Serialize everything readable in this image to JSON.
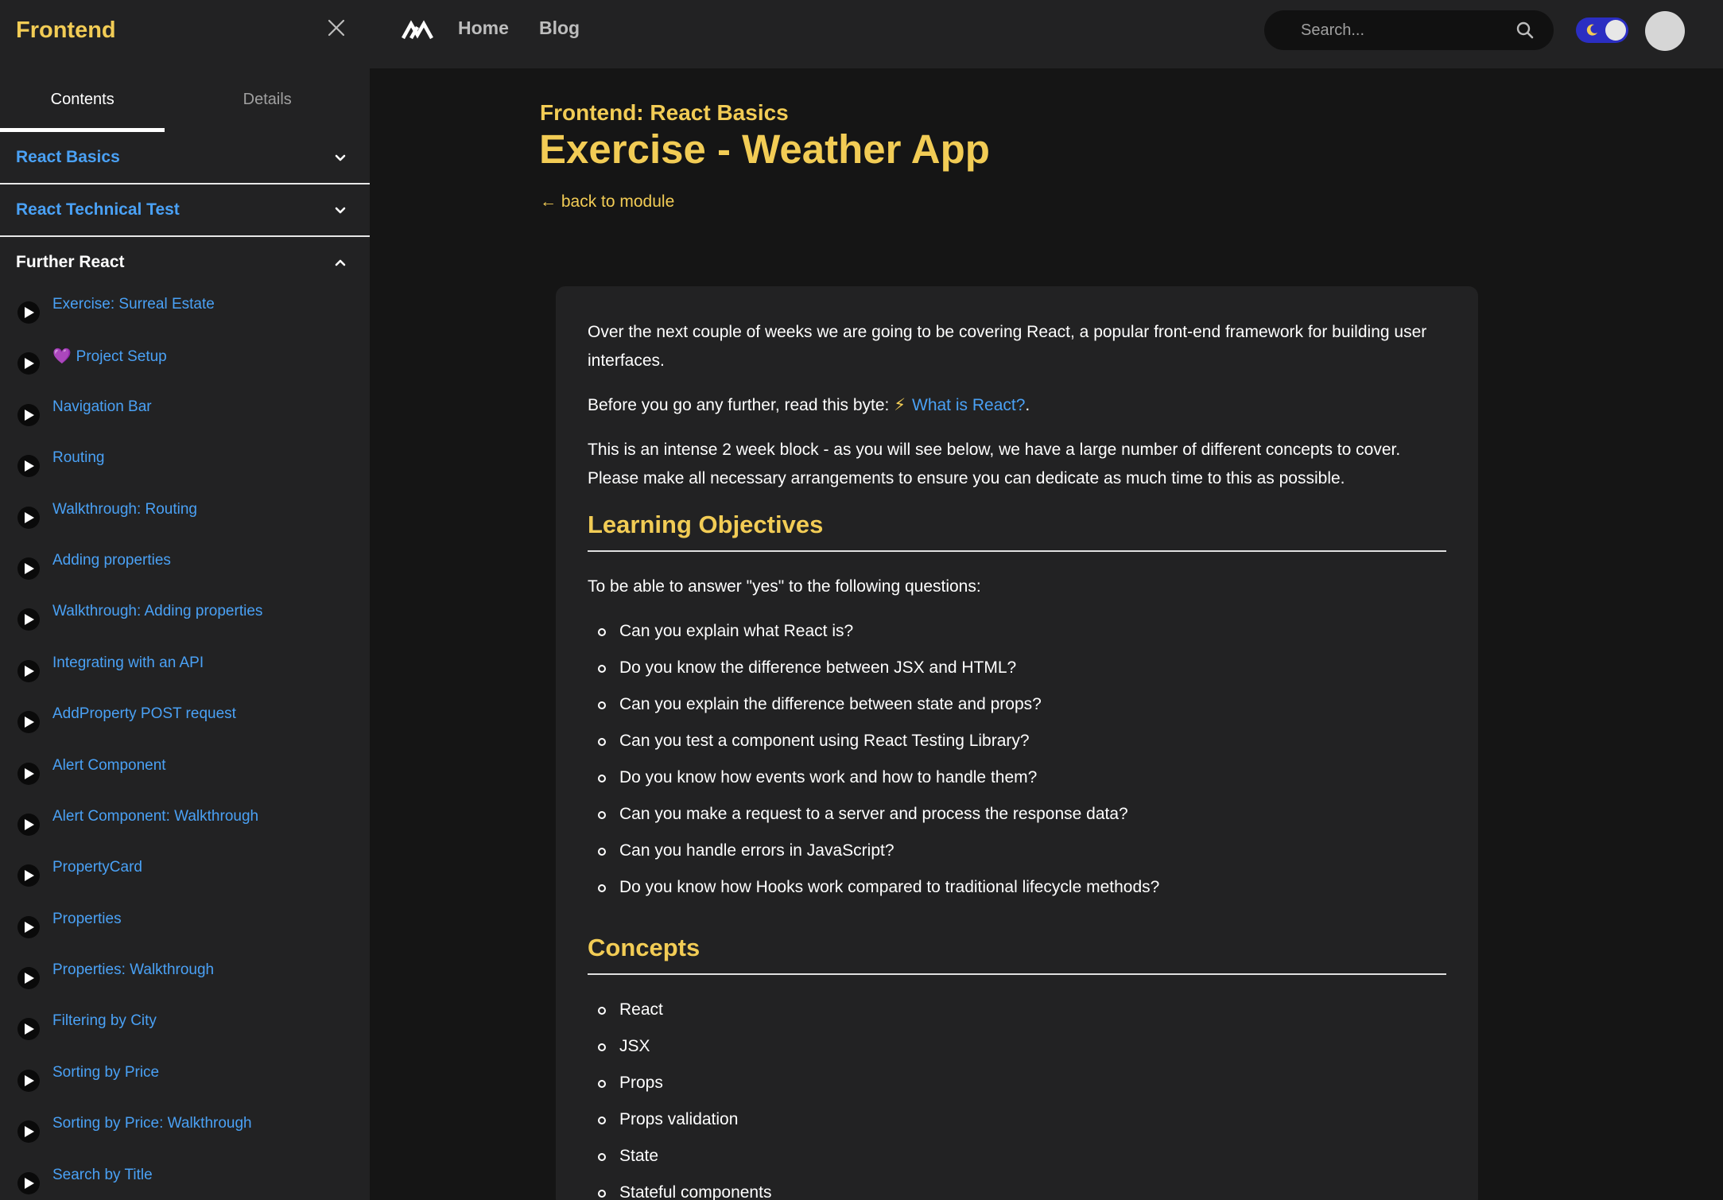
{
  "sidebar": {
    "title": "Frontend",
    "tabs": [
      "Contents",
      "Details"
    ],
    "sections": [
      {
        "label": "React Basics",
        "expanded": false
      },
      {
        "label": "React Technical Test",
        "expanded": false
      },
      {
        "label": "Further React",
        "expanded": true
      }
    ],
    "lessons": [
      {
        "label": "Exercise: Surreal Estate",
        "emoji": ""
      },
      {
        "label": "Project Setup",
        "emoji": "💜"
      },
      {
        "label": "Navigation Bar",
        "emoji": ""
      },
      {
        "label": "Routing",
        "emoji": ""
      },
      {
        "label": "Walkthrough: Routing",
        "emoji": ""
      },
      {
        "label": "Adding properties",
        "emoji": ""
      },
      {
        "label": "Walkthrough: Adding properties",
        "emoji": ""
      },
      {
        "label": "Integrating with an API",
        "emoji": ""
      },
      {
        "label": "AddProperty POST request",
        "emoji": ""
      },
      {
        "label": "Alert Component",
        "emoji": ""
      },
      {
        "label": "Alert Component: Walkthrough",
        "emoji": ""
      },
      {
        "label": "PropertyCard",
        "emoji": ""
      },
      {
        "label": "Properties",
        "emoji": ""
      },
      {
        "label": "Properties: Walkthrough",
        "emoji": ""
      },
      {
        "label": "Filtering by City",
        "emoji": ""
      },
      {
        "label": "Sorting by Price",
        "emoji": ""
      },
      {
        "label": "Sorting by Price: Walkthrough",
        "emoji": ""
      },
      {
        "label": "Search by Title",
        "emoji": ""
      }
    ]
  },
  "topbar": {
    "nav": [
      "Home",
      "Blog"
    ],
    "search_placeholder": "Search...",
    "theme_toggle": "dark"
  },
  "main": {
    "eyebrow": "Frontend: React Basics",
    "title": "Exercise - Weather App",
    "back_link": "← back to module",
    "intro1": "Over the next couple of weeks we are going to be covering React, a popular front-end framework for building user interfaces.",
    "intro2_prefix": "Before you go any further, read this byte:",
    "intro2_link": "What is React?",
    "intro2_suffix": ".",
    "intro3": "This is an intense 2 week block - as you will see below, we have a large number of different concepts to cover. Please make all necessary arrangements to ensure you can dedicate as much time to this as possible.",
    "objectives_heading": "Learning Objectives",
    "objectives_intro": "To be able to answer \"yes\" to the following questions:",
    "objectives": [
      "Can you explain what React is?",
      "Do you know the difference between JSX and HTML?",
      "Can you explain the difference between state and props?",
      "Can you test a component using React Testing Library?",
      "Do you know how events work and how to handle them?",
      "Can you make a request to a server and process the response data?",
      "Can you handle errors in JavaScript?",
      "Do you know how Hooks work compared to traditional lifecycle methods?"
    ],
    "concepts_heading": "Concepts",
    "concepts": [
      "React",
      "JSX",
      "Props",
      "Props validation",
      "State",
      "Stateful components"
    ]
  },
  "colors": {
    "accent_yellow": "#f2cc55",
    "link_blue": "#4aa1f5",
    "sidebar_bg": "#222223",
    "page_bg": "#151515",
    "toggle_blue": "#2b2ec2"
  }
}
